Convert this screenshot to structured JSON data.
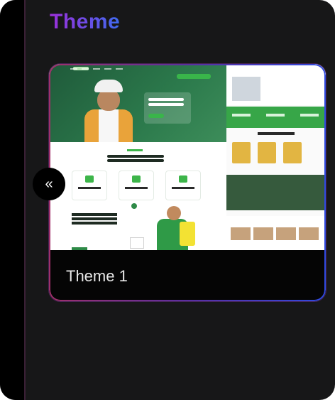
{
  "panel": {
    "title": "Theme"
  },
  "theme_card": {
    "caption": "Theme 1",
    "preview_alt_icon": "website-preview-thumbnail"
  },
  "collapse_button": {
    "icon": "double-chevron-left-icon",
    "glyph": "«"
  },
  "colors": {
    "panel_bg": "#171718",
    "title_gradient_start": "#9a2fd6",
    "title_gradient_end": "#3f6bf0",
    "preview_accent_green": "#39b54a",
    "caption_text": "#e8e8e8"
  }
}
